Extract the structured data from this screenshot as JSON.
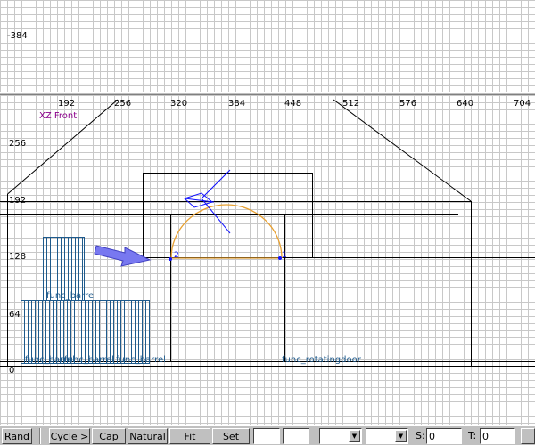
{
  "top_view": {
    "coord_label": "-384"
  },
  "front_view": {
    "view_label": "XZ Front",
    "x_ticks": [
      "192",
      "256",
      "320",
      "384",
      "448",
      "512",
      "576",
      "640",
      "704"
    ],
    "y_ticks": [
      "256",
      "192",
      "128",
      "64",
      "0"
    ],
    "entity_labels": [
      "func_barrel",
      "func_barrel",
      "func_barrel",
      "func_barrel",
      "func_rotatingdoor"
    ],
    "point_labels": [
      "2",
      "1"
    ],
    "colors": {
      "grid_bg": "#ffffff",
      "grid_minor": "#c8c8c8",
      "brush_lines": "#000000",
      "entity": "#1e5a8c",
      "view_label": "#8b008b",
      "arc": "#e8a030",
      "selection": "#1010ff",
      "arrow": "#7878f0"
    }
  },
  "toolbar": {
    "rand_label": "Rand",
    "cycle_label": "Cycle >",
    "cap_label": "Cap",
    "natural_label": "Natural",
    "fit_label": "Fit",
    "set_label": "Set",
    "field1_value": "",
    "field2_value": "",
    "dropdown1_value": "",
    "dropdown2_value": "",
    "s_label": "S:",
    "s_value": "0",
    "t_label": "T:",
    "t_value": "0"
  }
}
